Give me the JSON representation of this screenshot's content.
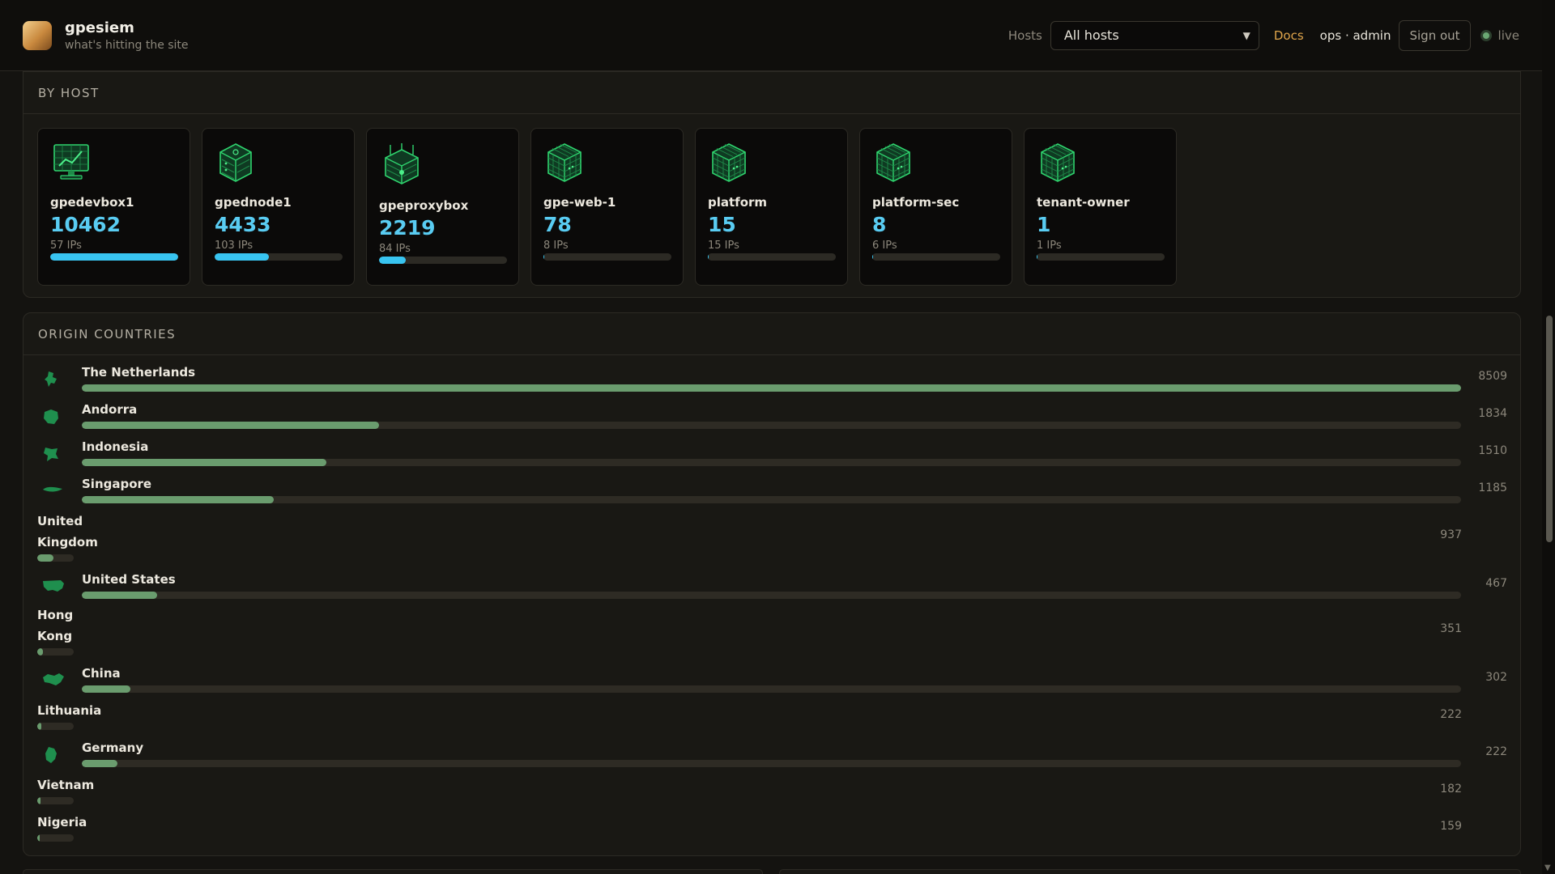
{
  "header": {
    "brand_title": "gpesiem",
    "brand_subtitle": "what's hitting the site",
    "hosts_label": "Hosts",
    "host_select_value": "All hosts",
    "docs_label": "Docs",
    "user_label": "ops · admin",
    "signout_label": "Sign out",
    "live_label": "live"
  },
  "host_panel": {
    "title": "BY HOST",
    "hosts": [
      {
        "name": "gpedevbox1",
        "count": "10462",
        "ips": "57 IPs",
        "share": 1.0,
        "icon": "monitor-icon"
      },
      {
        "name": "gpednode1",
        "count": "4433",
        "ips": "103 IPs",
        "share": 0.424,
        "icon": "server-icon"
      },
      {
        "name": "gpeproxybox",
        "count": "2219",
        "ips": "84 IPs",
        "share": 0.212,
        "icon": "router-icon"
      },
      {
        "name": "gpe-web-1",
        "count": "78",
        "ips": "8 IPs",
        "share": 0.0075,
        "icon": "cube-icon"
      },
      {
        "name": "platform",
        "count": "15",
        "ips": "15 IPs",
        "share": 0.0014,
        "icon": "cube-icon"
      },
      {
        "name": "platform-sec",
        "count": "8",
        "ips": "6 IPs",
        "share": 0.0008,
        "icon": "cube-icon"
      },
      {
        "name": "tenant-owner",
        "count": "1",
        "ips": "1 IPs",
        "share": 0.0001,
        "icon": "cube-icon"
      }
    ]
  },
  "country_panel": {
    "title": "ORIGIN COUNTRIES",
    "countries": [
      {
        "name": "The Netherlands",
        "value": "8509",
        "share": 1.0,
        "flag": "netherlands-map-icon"
      },
      {
        "name": "Andorra",
        "value": "1834",
        "share": 0.2155,
        "flag": "andorra-map-icon"
      },
      {
        "name": "Indonesia",
        "value": "1510",
        "share": 0.1775,
        "flag": "indonesia-map-icon"
      },
      {
        "name": "Singapore",
        "value": "1185",
        "share": 0.1393,
        "flag": "singapore-map-icon"
      },
      {
        "name": "United Kingdom",
        "value": "937",
        "share": 0.1101,
        "flag": ""
      },
      {
        "name": "United States",
        "value": "467",
        "share": 0.0549,
        "flag": "united-states-map-icon"
      },
      {
        "name": "Hong Kong",
        "value": "351",
        "share": 0.0413,
        "flag": ""
      },
      {
        "name": "China",
        "value": "302",
        "share": 0.0355,
        "flag": "china-map-icon"
      },
      {
        "name": "Lithuania",
        "value": "222",
        "share": 0.0261,
        "flag": ""
      },
      {
        "name": "Germany",
        "value": "222",
        "share": 0.0261,
        "flag": "germany-map-icon"
      },
      {
        "name": "Vietnam",
        "value": "182",
        "share": 0.0214,
        "flag": ""
      },
      {
        "name": "Nigeria",
        "value": "159",
        "share": 0.0187,
        "flag": ""
      }
    ]
  },
  "colors": {
    "accent_cyan": "#38c4f0",
    "accent_green": "#6a9c6e",
    "accent_orange": "#e0a54b",
    "icon_green": "#2fd46e"
  }
}
